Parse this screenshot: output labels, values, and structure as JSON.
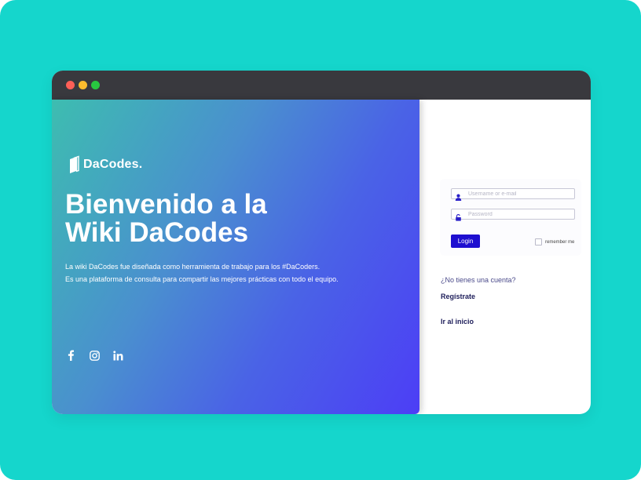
{
  "window": {
    "controls": [
      "close",
      "minimize",
      "maximize"
    ]
  },
  "hero": {
    "logo_text": "DaCodes.",
    "headline_line1": "Bienvenido a la",
    "headline_line2": "Wiki DaCodes",
    "desc_line1": "La wiki DaCodes fue diseñada como herramienta de trabajo para los #DaCoders.",
    "desc_line2": "Es una plataforma de consulta para compartir las mejores prácticas con todo el equipo.",
    "social_icons": [
      "facebook-icon",
      "instagram-icon",
      "linkedin-icon"
    ]
  },
  "login": {
    "username_placeholder": "Username or e-mail",
    "password_placeholder": "Password",
    "login_label": "Login",
    "remember_label": "remember me"
  },
  "links": {
    "question": "¿No tienes una cuenta?",
    "register": "Regístrate",
    "home": "Ir al inicio"
  },
  "colors": {
    "background": "#15d6cc",
    "titlebar": "#39393e",
    "login_button": "#1e0fd0",
    "gradient_start": "#3dbdb0",
    "gradient_end": "#4c3ef6"
  }
}
